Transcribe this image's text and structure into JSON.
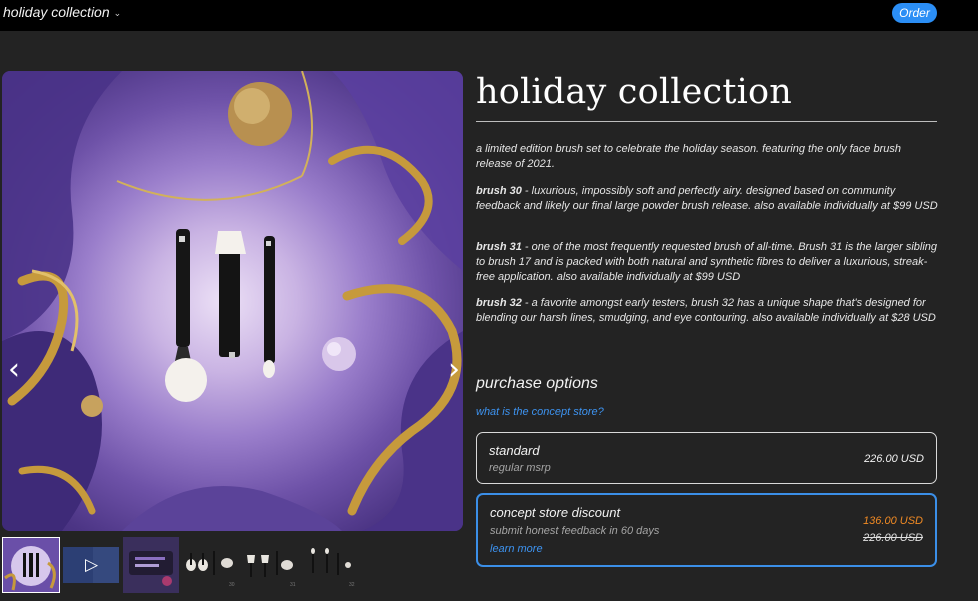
{
  "topbar": {
    "brand": "holiday collection",
    "order_label": "Order"
  },
  "hero": {
    "prev_label": "‹",
    "next_label": "›"
  },
  "thumbnails": [
    {
      "name": "collection photo",
      "active": true
    },
    {
      "name": "video"
    },
    {
      "name": "case photo"
    },
    {
      "name": "brush 30"
    },
    {
      "name": "brush 31"
    },
    {
      "name": "brush 32"
    }
  ],
  "thumb_numbers": [
    "30",
    "31",
    "32"
  ],
  "product": {
    "title": "holiday collection",
    "intro": "a limited edition brush set to celebrate the holiday season. featuring the only face brush release of 2021.",
    "brushes": [
      {
        "name": "brush 30",
        "text": " - luxurious, impossibly soft and perfectly airy. designed based on community feedback and likely our final large powder brush release. also available individually at $99 USD"
      },
      {
        "name": "brush 31",
        "text": " - one of the most frequently requested brush of all-time. Brush 31 is the larger sibling to brush 17 and is packed with both natural and synthetic fibres to deliver a luxurious, streak-free application. also available individually at $99 USD"
      },
      {
        "name": "brush 32",
        "text": " - a favorite amongst early testers, brush 32 has a unique shape that's designed for blending our harsh lines, smudging, and eye contouring. also available individually at $28 USD"
      }
    ]
  },
  "purchase": {
    "heading": "purchase options",
    "concept_link": "what is the concept store?",
    "standard": {
      "name": "standard",
      "sub": "regular msrp",
      "price": "226.00 USD"
    },
    "discount": {
      "name": "concept store discount",
      "sub": "submit honest feedback in 60 days",
      "learn_more": "learn more",
      "sale_price": "136.00 USD",
      "original_price": "226.00 USD"
    }
  },
  "colors": {
    "accent": "#2b8ef5",
    "sale": "#f08a24",
    "background": "#232323"
  }
}
